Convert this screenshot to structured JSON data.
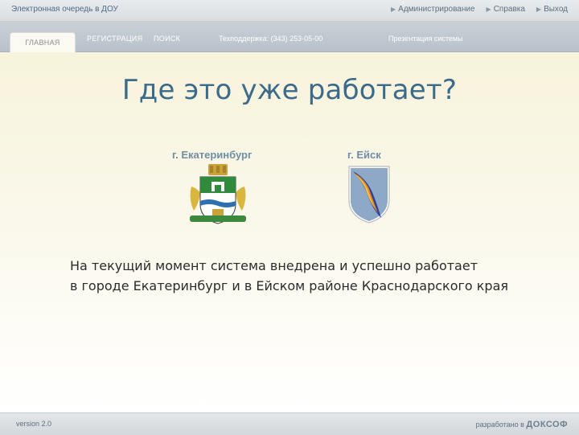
{
  "header": {
    "app_title": "Электронная очередь в ДОУ",
    "links": [
      {
        "label": "Администрирование",
        "icon": "arrow-right-icon"
      },
      {
        "label": "Справка",
        "icon": "arrow-right-icon"
      },
      {
        "label": "Выход",
        "icon": "arrow-right-icon"
      }
    ]
  },
  "nav": {
    "tabs": [
      {
        "label": "ГЛАВНАЯ",
        "active": true
      },
      {
        "label": "РЕГИСТРАЦИЯ",
        "active": false
      },
      {
        "label": "ПОИСК",
        "active": false
      }
    ],
    "support": "Техподдержка: (343) 253-05-00",
    "presentation": "Презентация системы"
  },
  "main": {
    "headline": "Где это уже работает?",
    "cities": [
      {
        "label": "г. Екатеринбург",
        "emblem": "ekaterinburg-coat-of-arms-icon"
      },
      {
        "label": "г. Ейск",
        "emblem": "yeysk-coat-of-arms-icon"
      }
    ],
    "description_line1": "На текущий момент система внедрена и успешно работает",
    "description_line2": "в городе Екатеринбург и в Ейском районе Краснодарского края"
  },
  "footer": {
    "version": "version 2.0",
    "developed_by": "разработано в",
    "developer_logo": "ДОКСОФ"
  },
  "colors": {
    "headline": "#3b6a8a",
    "city_label": "#6f8da5",
    "nav_bg": "#c0c8cf",
    "content_bg": "#f7f3dc"
  }
}
